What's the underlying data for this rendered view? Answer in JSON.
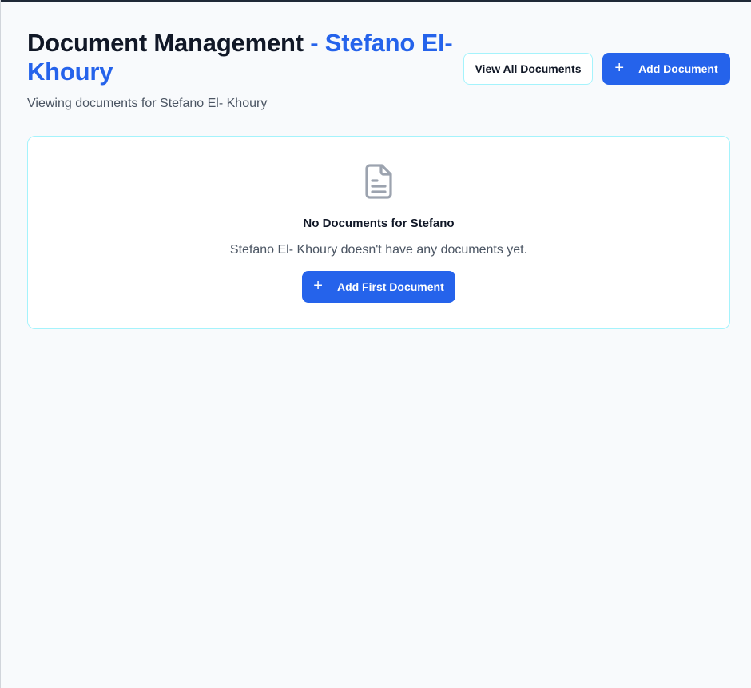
{
  "header": {
    "title": "Document Management",
    "title_accent": " - Stefano El- Khoury",
    "subtitle": "Viewing documents for Stefano El- Khoury"
  },
  "actions": {
    "view_all_label": "View All Documents",
    "add_label": "Add Document",
    "add_icon": "plus-icon"
  },
  "empty_state": {
    "icon": "document-icon",
    "title": "No Documents for Stefano",
    "message": "Stefano El- Khoury doesn't have any documents yet.",
    "button_label": "Add First Document"
  },
  "colors": {
    "accent": "#2563eb",
    "border": "#a5f3fc",
    "background": "#f8fafc",
    "icon": "#9ca3af"
  }
}
